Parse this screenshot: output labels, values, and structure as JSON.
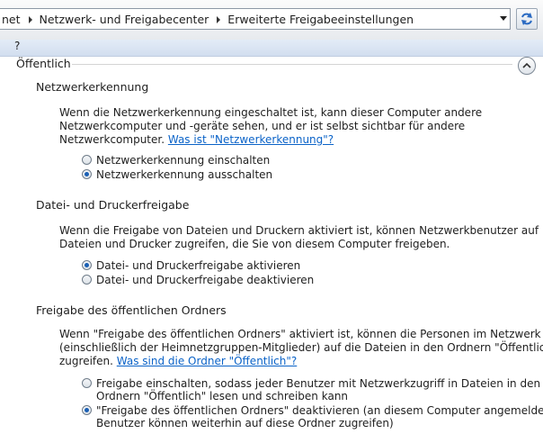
{
  "address_bar": {
    "crumbs": [
      "net",
      "Netzwerk- und Freigabecenter",
      "Erweiterte Freigabeeinstellungen"
    ]
  },
  "menu": {
    "help": "?"
  },
  "section": {
    "title": "Öffentlich"
  },
  "network_discovery": {
    "heading": "Netzwerkerkennung",
    "line1": "Wenn die Netzwerkerkennung eingeschaltet ist, kann dieser Computer andere",
    "line2": "Netzwerkcomputer und -geräte sehen, und er ist selbst sichtbar für andere",
    "line3": "Netzwerkcomputer.",
    "link": "Was ist \"Netzwerkerkennung\"?",
    "opt_on": "Netzwerkerkennung einschalten",
    "opt_off": "Netzwerkerkennung ausschalten",
    "selected": "off"
  },
  "file_printer": {
    "heading": "Datei- und Druckerfreigabe",
    "line1": "Wenn die Freigabe von Dateien und Druckern aktiviert ist, können Netzwerkbenutzer auf",
    "line2": "Dateien und Drucker zugreifen, die Sie von diesem Computer freigeben.",
    "opt_on": "Datei- und Druckerfreigabe aktivieren",
    "opt_off": "Datei- und Druckerfreigabe deaktivieren",
    "selected": "on"
  },
  "public_folder": {
    "heading": "Freigabe des öffentlichen Ordners",
    "line1": "Wenn \"Freigabe des öffentlichen Ordners\" aktiviert ist, können die Personen im Netzwerk",
    "line2": "(einschließlich der Heimnetzgruppen-Mitglieder) auf die Dateien in den Ordnern \"Öffentlich\"",
    "line3": "zugreifen.",
    "link": "Was sind die Ordner \"Öffentlich\"?",
    "opt_on_l1": "Freigabe einschalten, sodass jeder Benutzer mit Netzwerkzugriff in Dateien in den",
    "opt_on_l2": "Ordnern \"Öffentlich\" lesen und schreiben kann",
    "opt_off_l1": "\"Freigabe des öffentlichen Ordners\" deaktivieren (an diesem Computer angemeldete",
    "opt_off_l2": "Benutzer können weiterhin auf diese Ordner zugreifen)",
    "selected": "off"
  }
}
